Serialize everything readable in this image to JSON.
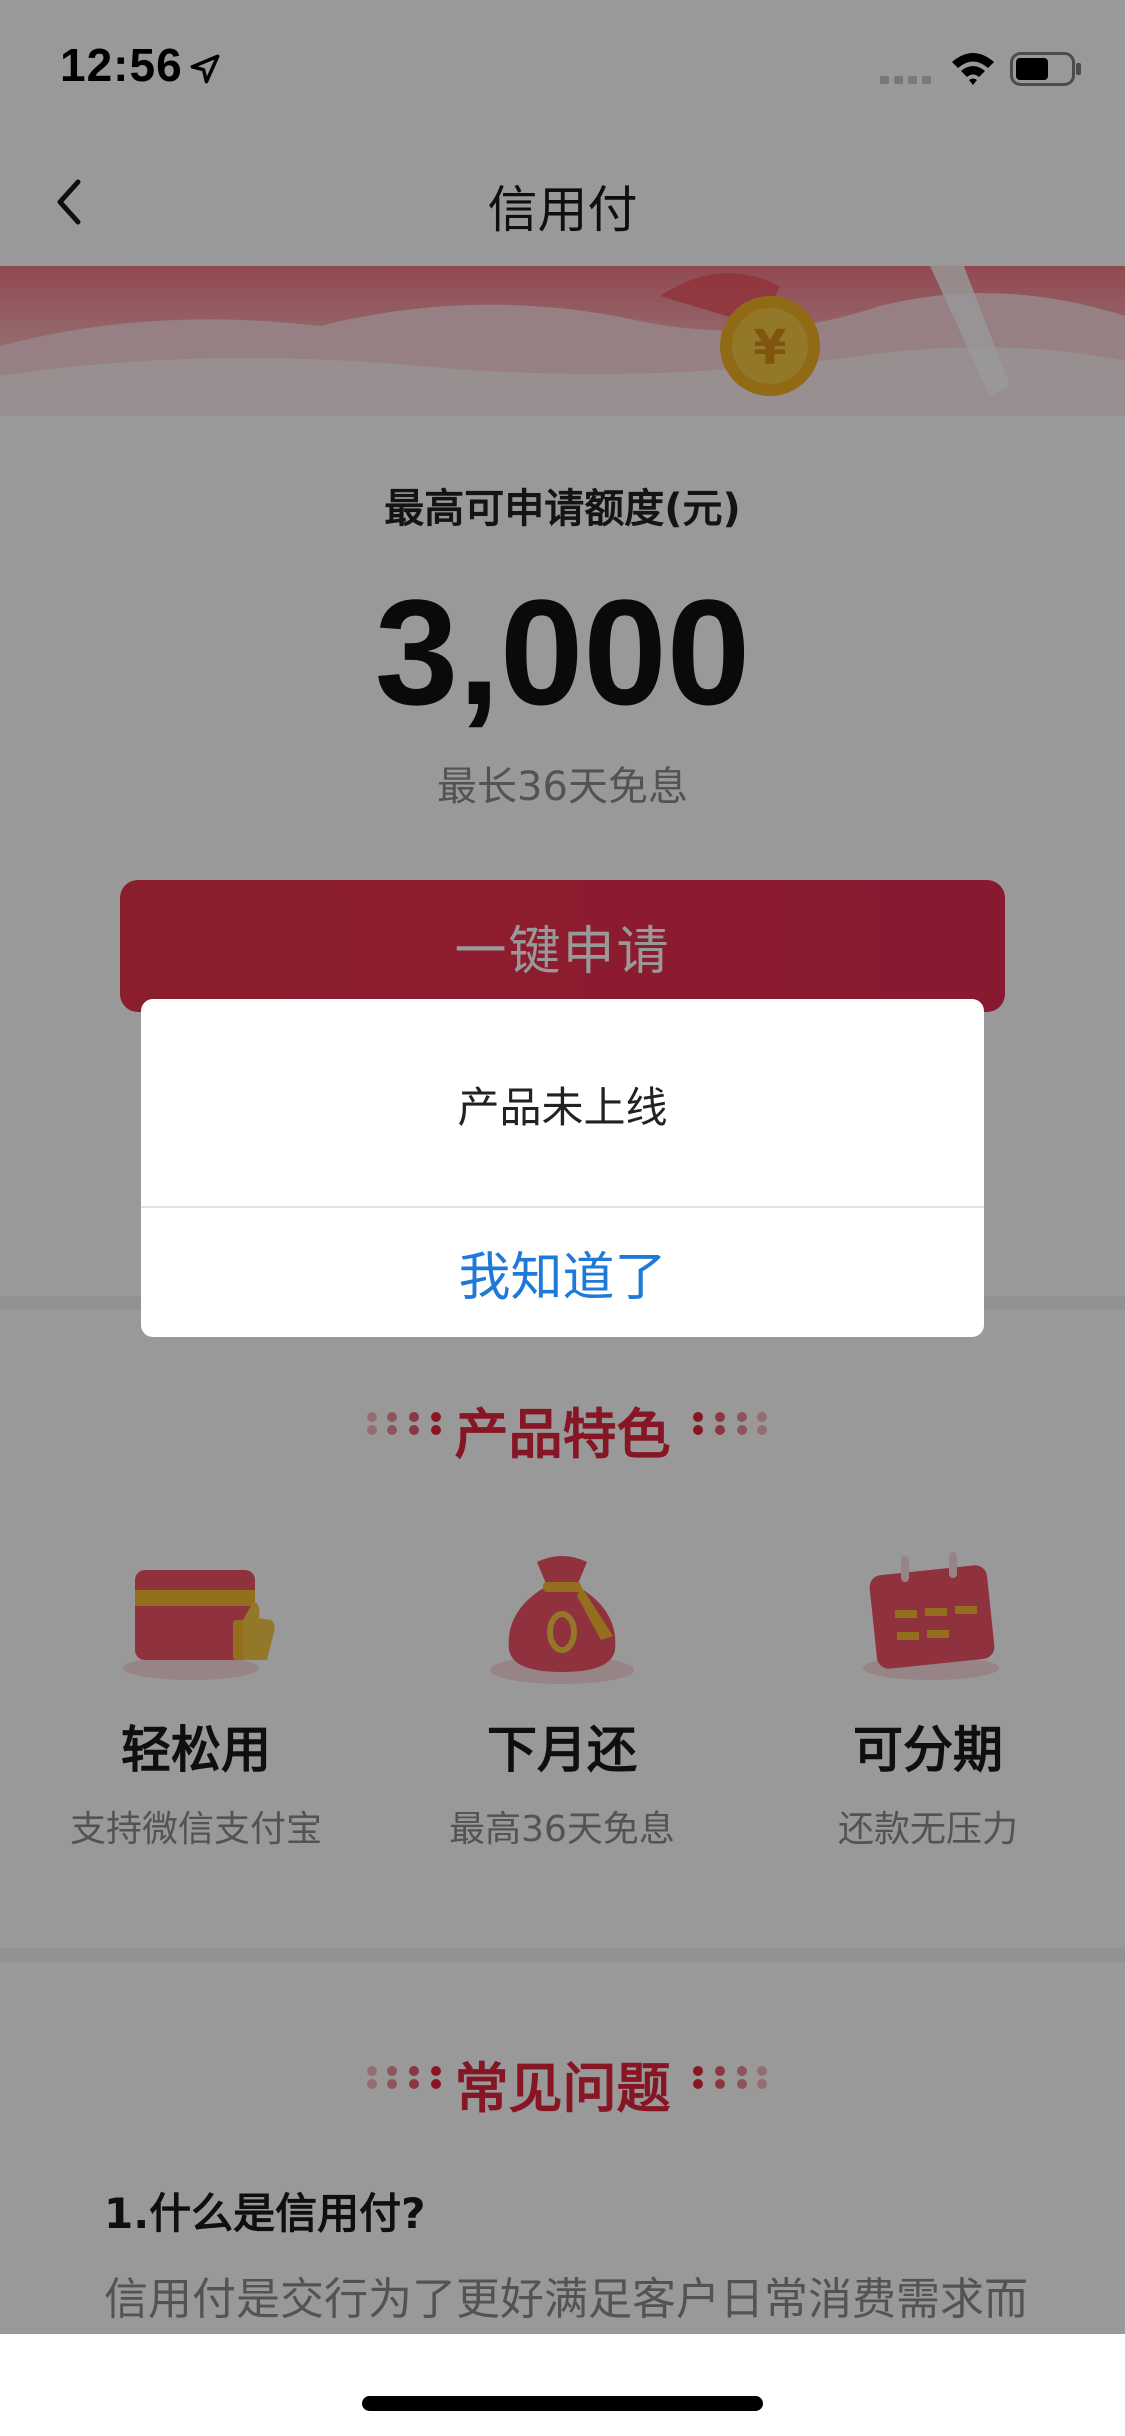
{
  "status_bar": {
    "time": "12:56"
  },
  "nav": {
    "title": "信用付"
  },
  "hero": {
    "limit_label": "最高可申请额度(元)",
    "limit_amount": "3,000",
    "interest_note": "最长36天免息",
    "apply_label": "一键申请"
  },
  "features": {
    "title": "产品特色",
    "items": [
      {
        "title": "轻松用",
        "subtitle": "支持微信支付宝",
        "icon": "card-icon"
      },
      {
        "title": "下月还",
        "subtitle": "最高36天免息",
        "icon": "money-bag-icon"
      },
      {
        "title": "可分期",
        "subtitle": "还款无压力",
        "icon": "calendar-icon"
      }
    ]
  },
  "faq": {
    "title": "常见问题",
    "question_1": "1.什么是信用付?",
    "answer_1": "信用付是交行为了更好满足客户日常消费需求而"
  },
  "dialog": {
    "message": "产品未上线",
    "button_label": "我知道了"
  },
  "colors": {
    "accent_red": "#e2263f",
    "dialog_button_blue": "#1f79d6"
  }
}
